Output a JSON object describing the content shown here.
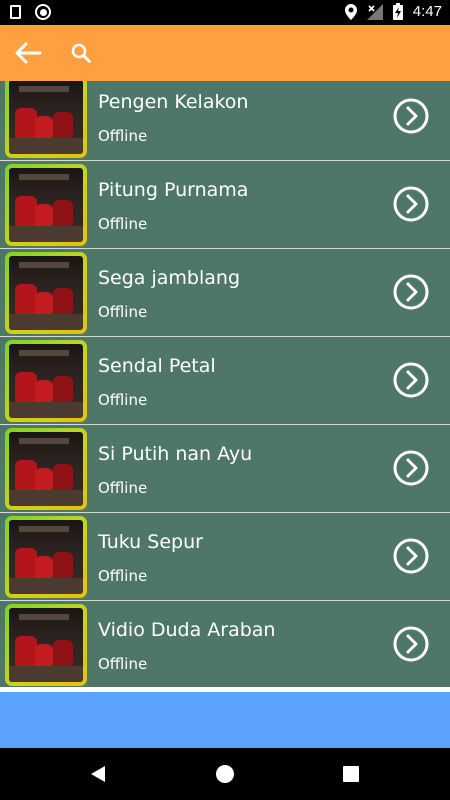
{
  "status_bar": {
    "time": "4:47",
    "icons": [
      "sim-card-icon",
      "record-icon",
      "location-icon",
      "signal-off-icon",
      "battery-charging-icon"
    ]
  },
  "app_bar": {
    "icons": [
      "back-arrow-icon",
      "search-icon"
    ],
    "color": "#FFA040"
  },
  "songs": [
    {
      "title": "Pengen Kelakon",
      "status": "Offline"
    },
    {
      "title": "Pitung Purnama",
      "status": "Offline"
    },
    {
      "title": "Sega jamblang",
      "status": "Offline"
    },
    {
      "title": "Sendal Petal",
      "status": "Offline"
    },
    {
      "title": "Si Putih nan Ayu",
      "status": "Offline"
    },
    {
      "title": "Tuku Sepur",
      "status": "Offline"
    },
    {
      "title": "Vidio Duda Araban",
      "status": "Offline"
    }
  ],
  "colors": {
    "list_item": "#4E7768",
    "banner": "#5BA2FF"
  },
  "nav_bar": {
    "icons": [
      "nav-back-icon",
      "nav-home-icon",
      "nav-recents-icon"
    ]
  }
}
